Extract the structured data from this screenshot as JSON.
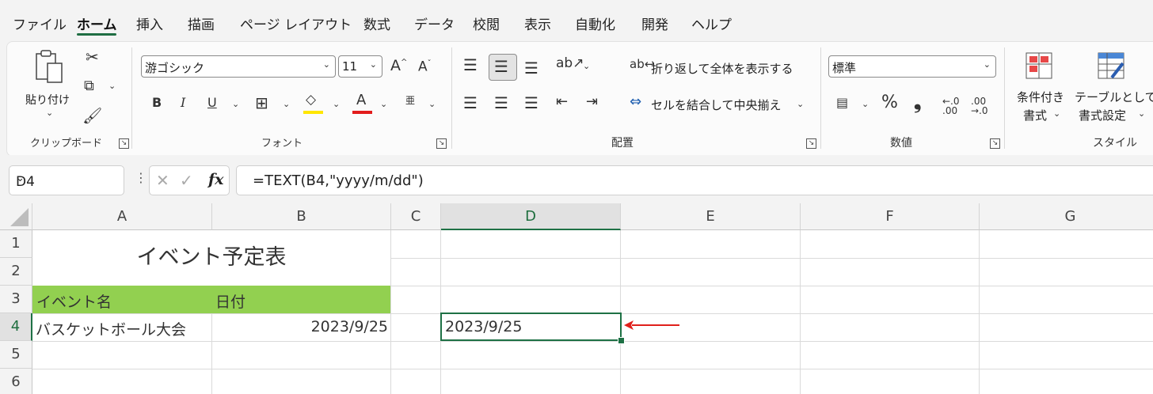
{
  "menu": {
    "tabs": [
      "ファイル",
      "ホーム",
      "挿入",
      "描画",
      "ページ レイアウト",
      "数式",
      "データ",
      "校閲",
      "表示",
      "自動化",
      "開発",
      "ヘルプ"
    ],
    "active": "ホーム"
  },
  "ribbon": {
    "clipboard": {
      "paste_label": "貼り付け",
      "group_label": "クリップボード"
    },
    "font": {
      "font_name": "游ゴシック",
      "font_size": "11",
      "group_label": "フォント",
      "bold": "B",
      "italic": "I",
      "underline": "U"
    },
    "alignment": {
      "wrap_label": "折り返して全体を表示する",
      "merge_label": "セルを結合して中央揃え",
      "group_label": "配置"
    },
    "number": {
      "format": "標準",
      "percent": "%",
      "comma": "❟",
      "group_label": "数値"
    },
    "styles": {
      "cond_format_line1": "条件付き",
      "cond_format_line2": "書式",
      "table_format_line1": "テーブルとして",
      "table_format_line2": "書式設定",
      "group_label": "スタイル"
    }
  },
  "formula_bar": {
    "name_box": "D4",
    "fx": "fx",
    "formula": "=TEXT(B4,\"yyyy/m/dd\")"
  },
  "sheet": {
    "columns": [
      "A",
      "B",
      "C",
      "D",
      "E",
      "F",
      "G"
    ],
    "rows": [
      "1",
      "2",
      "3",
      "4",
      "5",
      "6"
    ],
    "selected_cell": "D4",
    "title": "イベント予定表",
    "header_event": "イベント名",
    "header_date": "日付",
    "event_name": "バスケットボール大会",
    "event_date": "2023/9/25",
    "result": "2023/9/25"
  },
  "colors": {
    "header_fill": "#92d050",
    "selection": "#1e7145",
    "arrow": "#e0201b",
    "font_color_bar": "#e21c1c",
    "fill_color_bar": "#ffe600"
  }
}
